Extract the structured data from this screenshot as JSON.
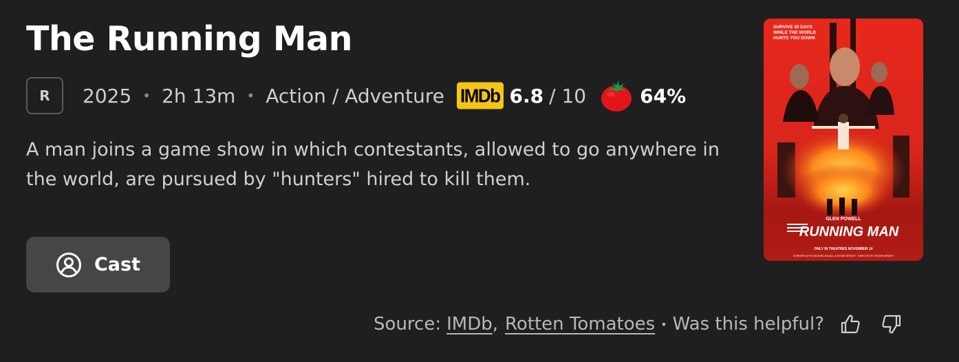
{
  "movie": {
    "title": "The Running Man",
    "rating": "R",
    "year": "2025",
    "runtime": "2h 13m",
    "genres": "Action / Adventure",
    "description": "A man joins a game show in which contestants, allowed to go anywhere in the world, are pursued by \"hunters\" hired to kill them."
  },
  "scores": {
    "imdb_badge": "IMDb",
    "imdb_score": "6.8",
    "imdb_scale": "/ 10",
    "rt_icon": "tomato-icon",
    "rt_score": "64%"
  },
  "cast_button": {
    "label": "Cast",
    "icon": "person-circle-icon"
  },
  "poster": {
    "tagline": "SURVIVE 30 DAYS WHILE THE WORLD HUNTS YOU DOWN",
    "actor": "GLEN POWELL",
    "logo": "THE RUNNING MAN",
    "release": "ONLY IN THEATRES NOVEMBER 14"
  },
  "footer": {
    "source_label": "Source:",
    "source_imdb": "IMDb",
    "comma": ",",
    "source_rt": "Rotten Tomatoes",
    "bullet": "•",
    "helpful": "Was this helpful?",
    "thumbs_up_icon": "thumbs-up-icon",
    "thumbs_down_icon": "thumbs-down-icon"
  },
  "colors": {
    "background": "#1f1f1f",
    "imdb_yellow": "#f5c518",
    "tomato_red": "#e3151a",
    "button_bg": "#464646"
  }
}
